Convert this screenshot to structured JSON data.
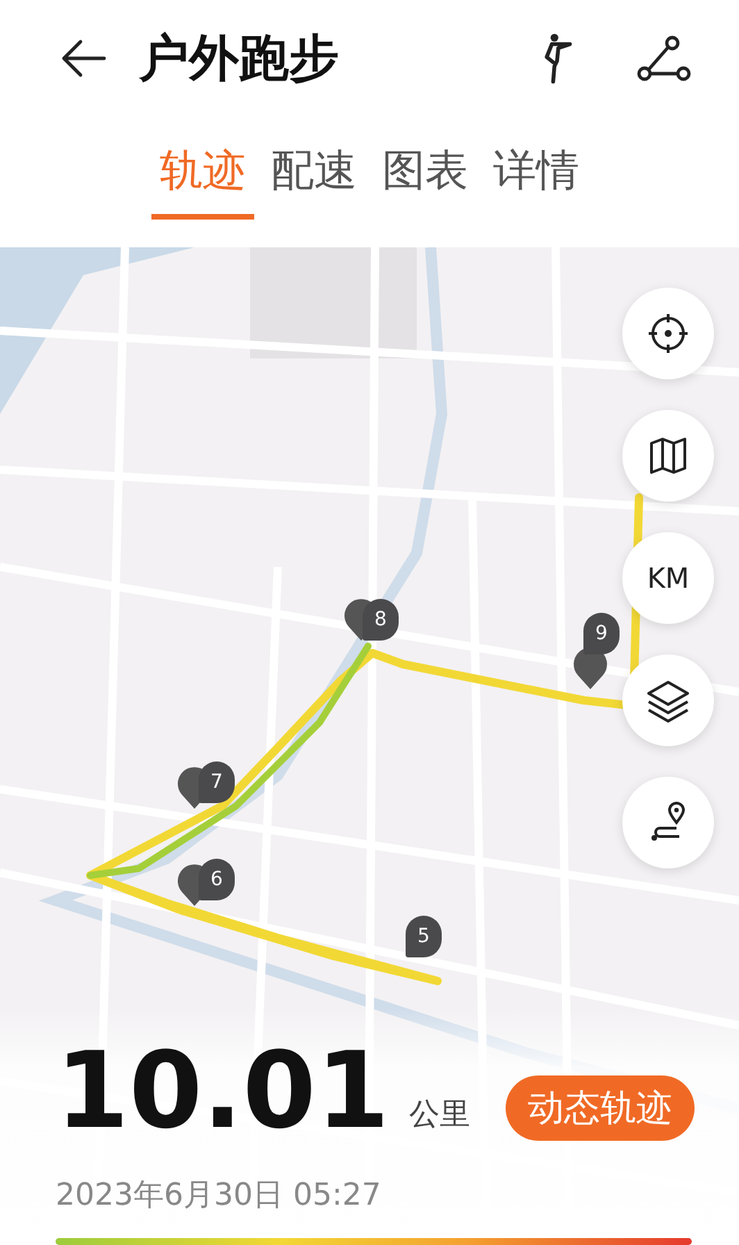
{
  "header": {
    "title": "户外跑步"
  },
  "tabs": [
    {
      "label": "轨迹",
      "selected": true
    },
    {
      "label": "配速",
      "selected": false
    },
    {
      "label": "图表",
      "selected": false
    },
    {
      "label": "详情",
      "selected": false
    }
  ],
  "map": {
    "km_markers": [
      {
        "label": "8"
      },
      {
        "label": "9"
      },
      {
        "label": "7"
      },
      {
        "label": "6"
      },
      {
        "label": "5"
      }
    ],
    "controls": [
      {
        "kind": "locate"
      },
      {
        "kind": "map"
      },
      {
        "kind": "text",
        "label": "KM"
      },
      {
        "kind": "layers"
      },
      {
        "kind": "route"
      }
    ]
  },
  "summary": {
    "distance": "10.01",
    "unit": "公里",
    "replay_button": "动态轨迹",
    "date": "2023年6月30日 05:27"
  }
}
